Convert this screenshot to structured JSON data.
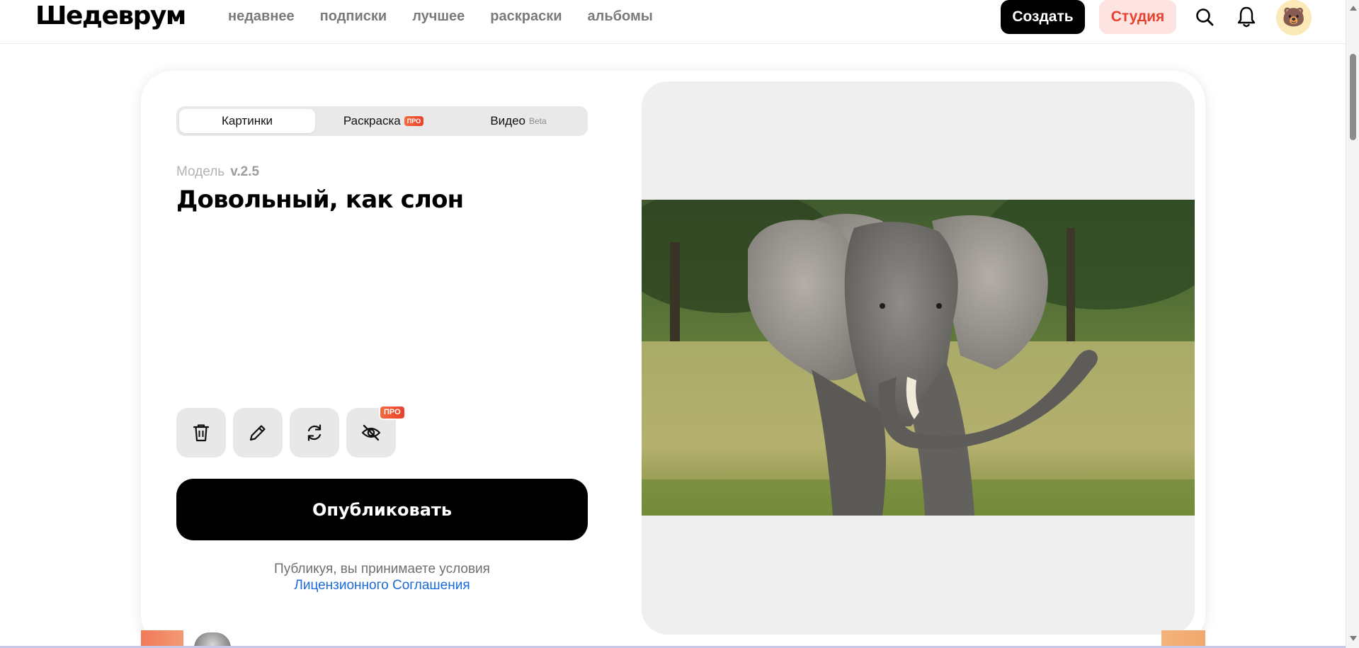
{
  "header": {
    "logo": "Шедеврум",
    "nav": [
      "недавнее",
      "подписки",
      "лучшее",
      "раскраски",
      "альбомы"
    ],
    "create_label": "Создать",
    "studio_label": "Студия",
    "icons": [
      "search-icon",
      "bell-icon"
    ],
    "avatar_emoji": "🐻"
  },
  "tabs": {
    "items": [
      {
        "label": "Картинки",
        "active": true
      },
      {
        "label": "Раскраска",
        "badge": "ПРО"
      },
      {
        "label": "Видео",
        "badge": "Beta"
      }
    ]
  },
  "model": {
    "label": "Модель",
    "version": "v.2.5"
  },
  "prompt": {
    "title": "Довольный, как слон"
  },
  "actions": {
    "icons": [
      "trash-icon",
      "pencil-icon",
      "refresh-icon",
      "eye-off-icon"
    ],
    "pro_badge": "ПРО"
  },
  "publish_label": "Опубликовать",
  "terms": {
    "text": "Публикуя, вы принимаете условия",
    "link": "Лицензионного Соглашения"
  },
  "colors": {
    "accent_red": "#e8412f",
    "studio_bg": "#fde4e0",
    "link_blue": "#1a6ad8"
  }
}
